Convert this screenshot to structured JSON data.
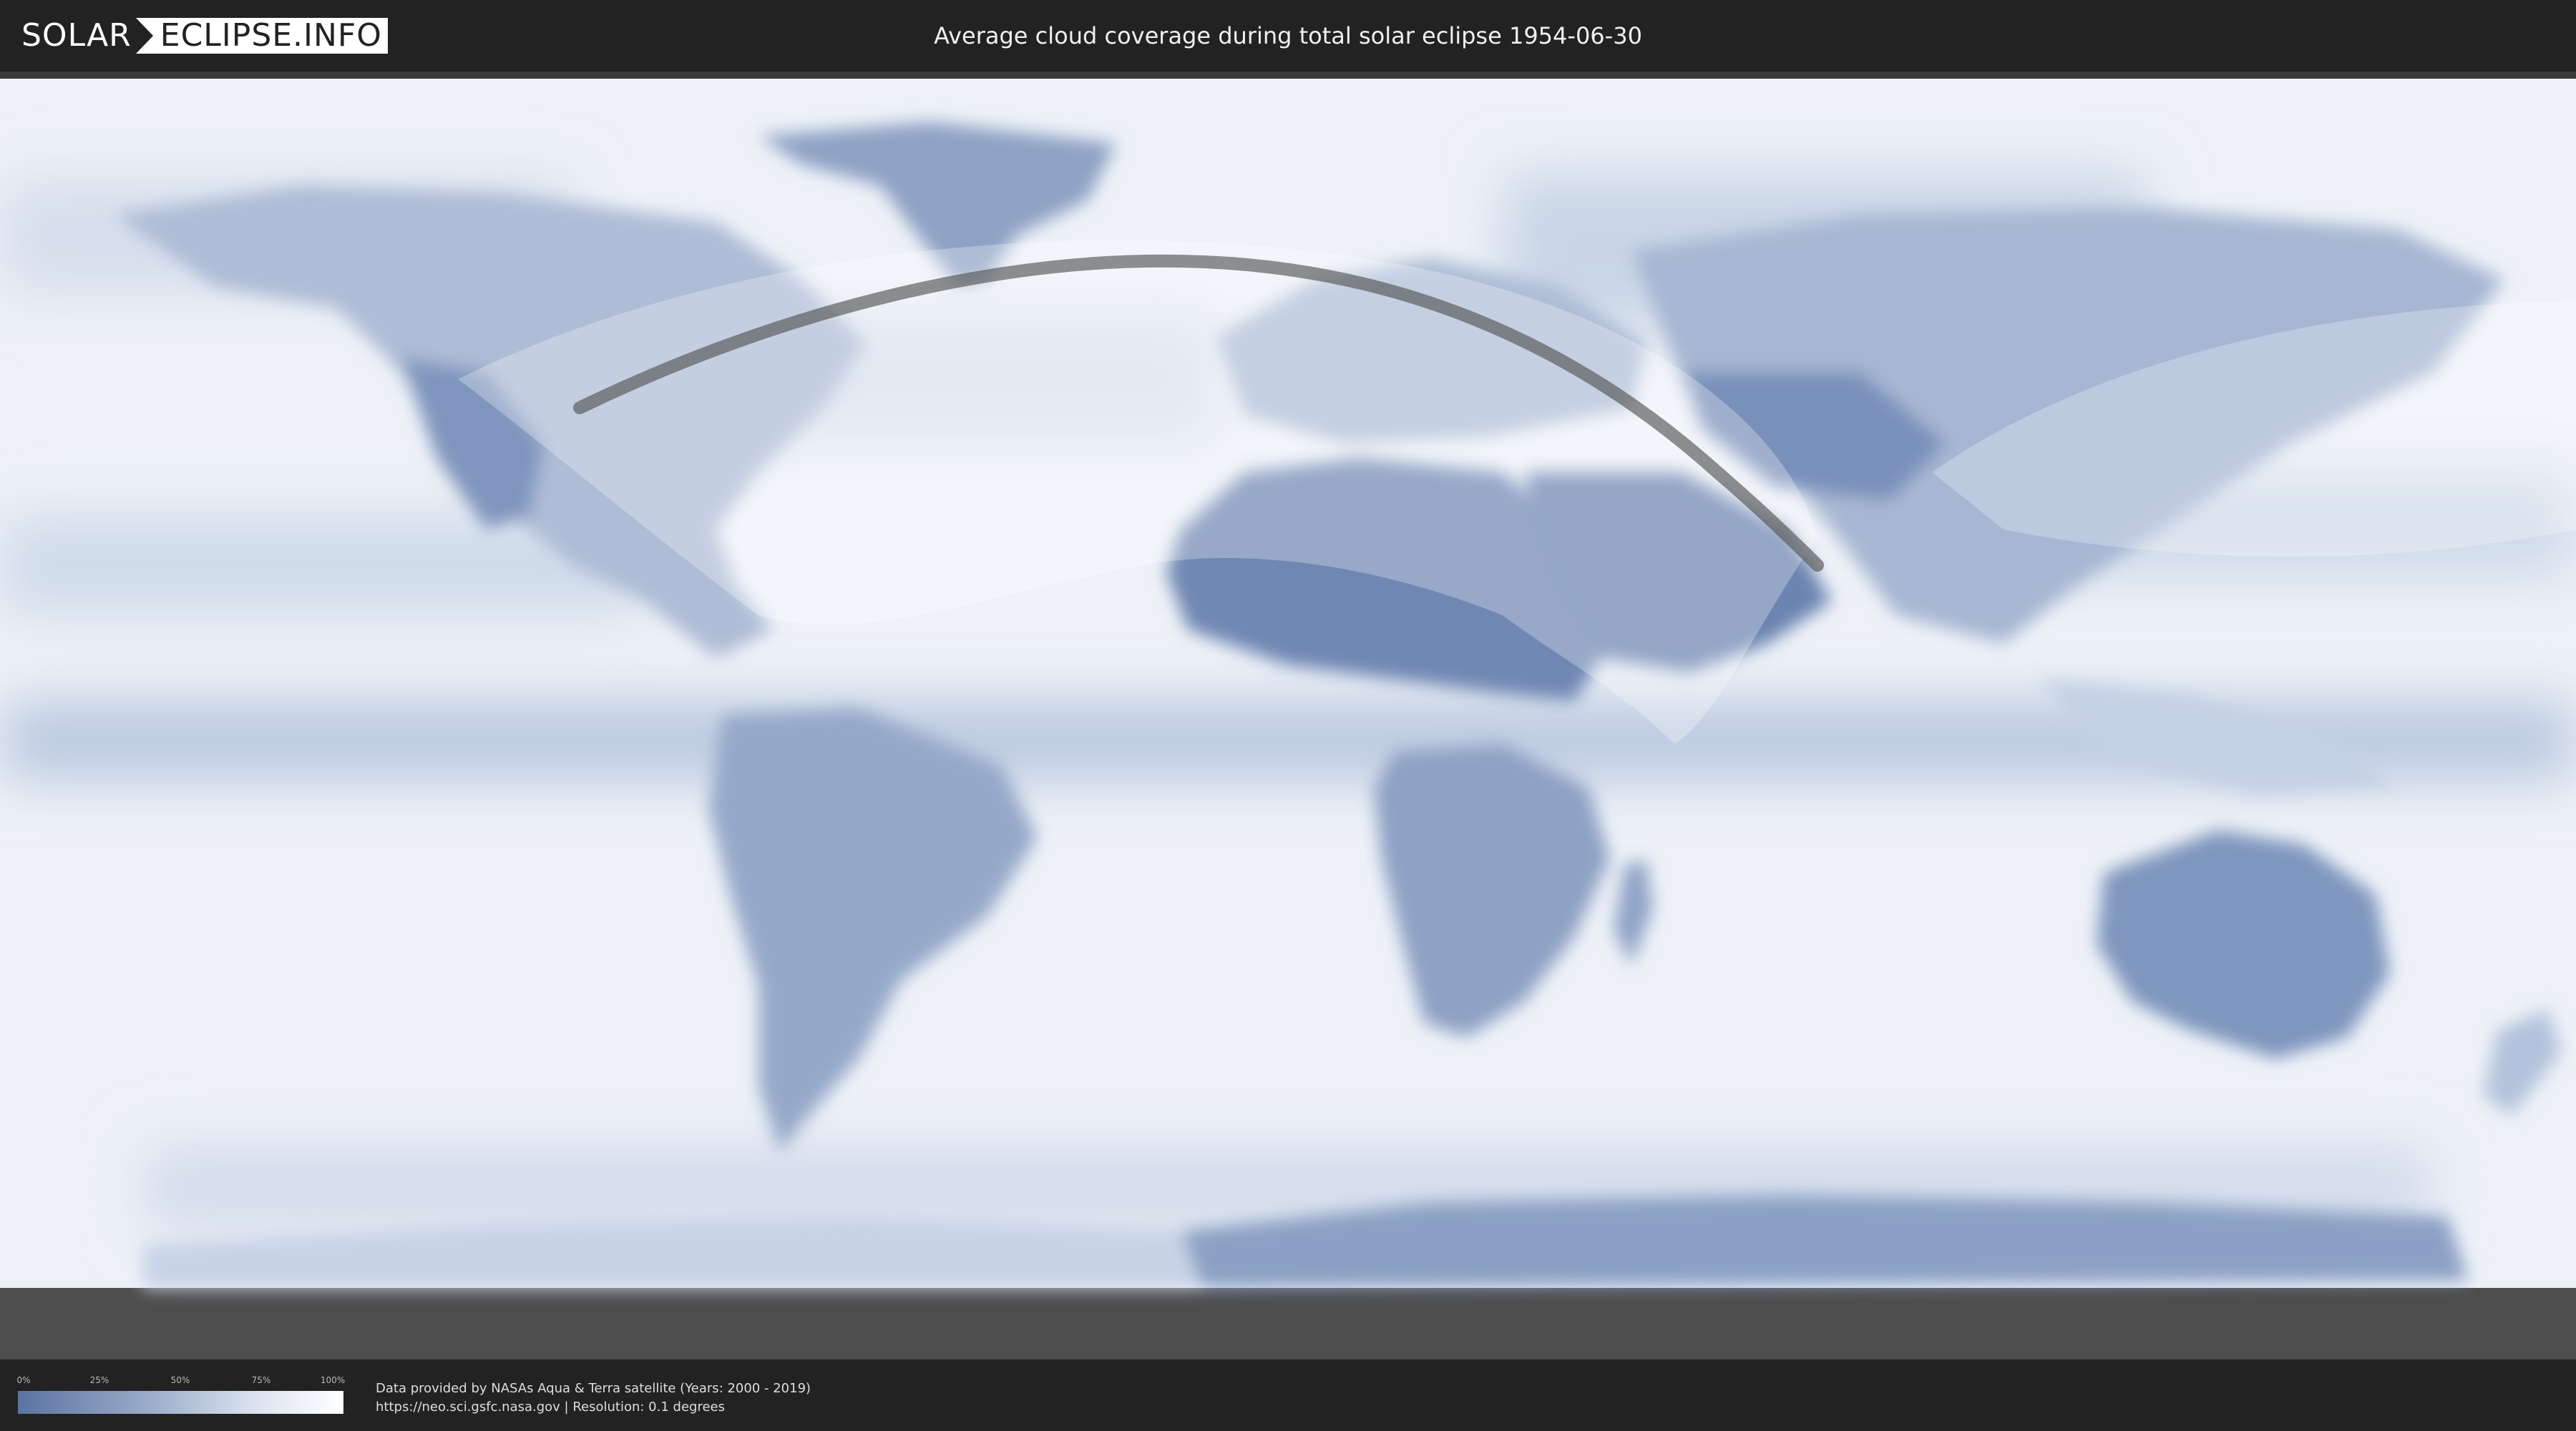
{
  "header": {
    "logo_left": "SOLAR",
    "logo_right": "ECLIPSE.INFO",
    "title": "Average cloud coverage during total solar eclipse 1954-06-30"
  },
  "legend": {
    "ticks": [
      "0%",
      "25%",
      "50%",
      "75%",
      "100%"
    ],
    "colors": [
      "#5b73a1",
      "#9aacca",
      "#dfe6f1",
      "#ffffff"
    ]
  },
  "credit": {
    "line1": "Data provided by NASAs Aqua & Terra satellite (Years: 2000 - 2019)",
    "line2": "https://neo.sci.gsfc.nasa.gov | Resolution: 0.1 degrees"
  },
  "map": {
    "projection": "equirectangular",
    "layer": "average-cloud-coverage",
    "ocean_color": "#eef2f8",
    "clear_sky_color": "#5b73a1",
    "eclipse_path_color": "#555555",
    "visibility_zone_color": "#ffffff"
  }
}
